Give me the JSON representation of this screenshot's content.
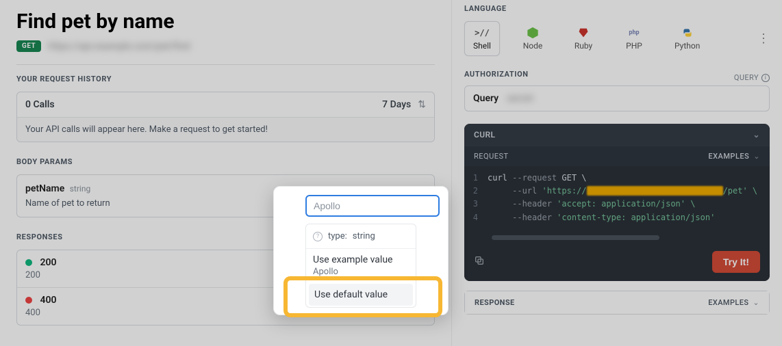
{
  "page": {
    "title": "Find pet by name",
    "method": "GET",
    "endpoint_blur": "https://api.example.com/pet/find"
  },
  "history": {
    "heading": "YOUR REQUEST HISTORY",
    "calls": "0 Calls",
    "range": "7 Days",
    "empty": "Your API calls will appear here. Make a request to get started!"
  },
  "bodyParams": {
    "heading": "BODY PARAMS",
    "items": [
      {
        "name": "petName",
        "type": "string",
        "description": "Name of pet to return"
      }
    ]
  },
  "responses": {
    "heading": "RESPONSES",
    "items": [
      {
        "code": "200",
        "label": "200",
        "color": "green"
      },
      {
        "code": "400",
        "label": "400",
        "color": "red"
      }
    ]
  },
  "language": {
    "heading": "LANGUAGE",
    "items": [
      {
        "name": "Shell",
        "selected": true,
        "icon": "shell"
      },
      {
        "name": "Node",
        "selected": false,
        "icon": "node"
      },
      {
        "name": "Ruby",
        "selected": false,
        "icon": "ruby"
      },
      {
        "name": "PHP",
        "selected": false,
        "icon": "php"
      },
      {
        "name": "Python",
        "selected": false,
        "icon": "python"
      }
    ]
  },
  "auth": {
    "heading": "AUTHORIZATION",
    "hint": "QUERY",
    "label": "Query",
    "value": "secret"
  },
  "code": {
    "shell_label": "CURL",
    "request_label": "REQUEST",
    "examples_label": "EXAMPLES",
    "try_it": "Try It!",
    "lines": [
      {
        "n": 1,
        "pre": "curl ",
        "flag": "--request",
        "rest": " GET \\"
      },
      {
        "n": 2,
        "pre": "     ",
        "flag": "--url",
        "url_open": " 'https://",
        "url_blur": "petstore.example.com/api/v2",
        "url_close": "/pet' \\",
        "is_url": true
      },
      {
        "n": 3,
        "pre": "     ",
        "flag": "--header",
        "str": " 'accept: application/json' \\"
      },
      {
        "n": 4,
        "pre": "     ",
        "flag": "--header",
        "str": " 'content-type: application/json'"
      }
    ]
  },
  "response": {
    "heading": "RESPONSE",
    "examples_label": "EXAMPLES"
  },
  "popover": {
    "placeholder": "Apollo",
    "type_key": "type:",
    "type_val": "string",
    "use_example": "Use example value",
    "example_val": "Apollo",
    "use_default": "Use default value"
  }
}
